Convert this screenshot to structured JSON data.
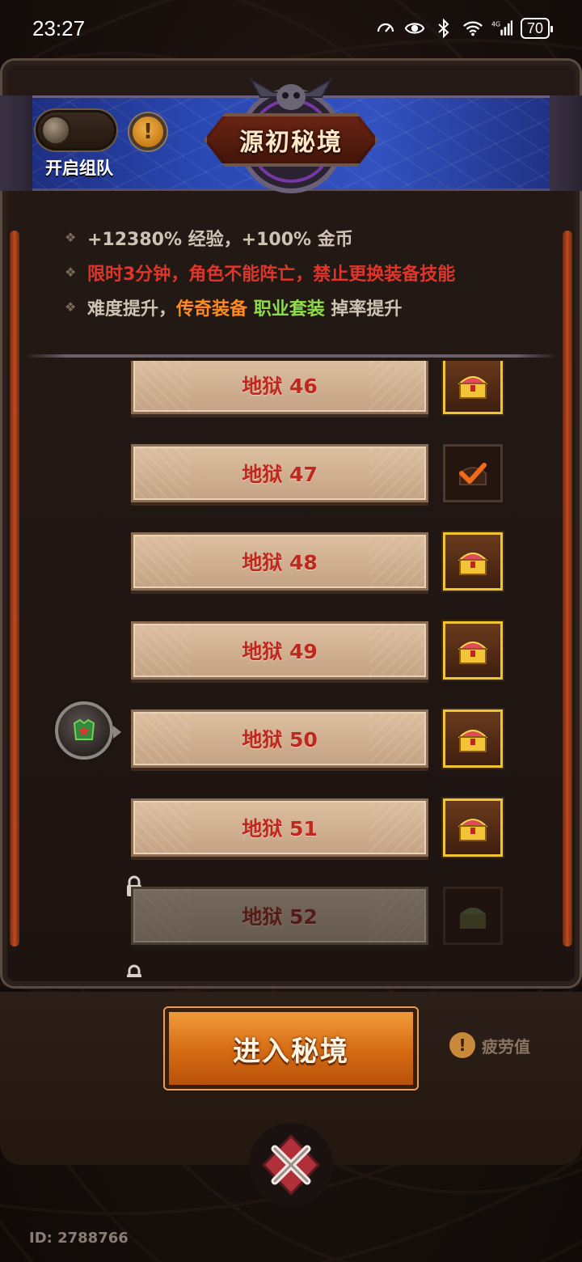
{
  "status_bar": {
    "time": "23:27",
    "battery": "70",
    "icons": [
      "speed-icon",
      "eye-icon",
      "bluetooth-icon",
      "wifi-icon",
      "signal-4g-icon",
      "battery-icon"
    ]
  },
  "header": {
    "title": "源初秘境",
    "team_toggle_label": "开启组队",
    "team_toggle_on": false,
    "info_symbol": "!"
  },
  "buffs": {
    "line1": "+12380% 经验，+100% 金币",
    "line2": "限时3分钟，角色不能阵亡，禁止更换装备技能",
    "line3_prefix": "难度提升，",
    "line3_legendary": "传奇装备",
    "line3_set": "职业套装",
    "line3_suffix": "掉率提升"
  },
  "levels": [
    {
      "label": "地狱 46",
      "chest": "available",
      "locked": false
    },
    {
      "label": "地狱 47",
      "chest": "claimed",
      "locked": false
    },
    {
      "label": "地狱 48",
      "chest": "available",
      "locked": false
    },
    {
      "label": "地狱 49",
      "chest": "available",
      "locked": false
    },
    {
      "label": "地狱 50",
      "chest": "available",
      "locked": false,
      "current": true
    },
    {
      "label": "地狱 51",
      "chest": "available",
      "locked": false
    },
    {
      "label": "地狱 52",
      "chest": "locked",
      "locked": true
    }
  ],
  "actions": {
    "enter_label": "进入秘境",
    "fatigue_label": "疲劳值",
    "fatigue_symbol": "!"
  },
  "footer": {
    "player_id": "ID: 2788766"
  },
  "colors": {
    "accent_orange": "#d56a12",
    "danger_red": "#e0352b",
    "legendary_orange": "#ff8a1f",
    "set_green": "#8ddd4a",
    "chest_gold": "#f0c530"
  }
}
